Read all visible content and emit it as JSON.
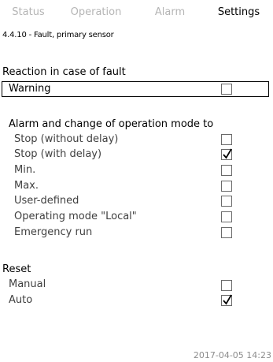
{
  "tabs": [
    {
      "label": "Status",
      "active": false
    },
    {
      "label": "Operation",
      "active": false
    },
    {
      "label": "Alarm",
      "active": false
    },
    {
      "label": "Settings",
      "active": true
    }
  ],
  "menu_path": "4.4.10 - Fault, primary sensor",
  "reaction_section": {
    "title": "Reaction in case of fault",
    "warning": {
      "label": "Warning",
      "checked": false
    }
  },
  "alarm_section": {
    "title": "Alarm and change of operation mode to",
    "items": [
      {
        "label": "Stop (without delay)",
        "checked": false
      },
      {
        "label": "Stop (with delay)",
        "checked": true
      },
      {
        "label": "Min.",
        "checked": false
      },
      {
        "label": "Max.",
        "checked": false
      },
      {
        "label": "User-defined",
        "checked": false
      },
      {
        "label": "Operating mode \"Local\"",
        "checked": false
      },
      {
        "label": "Emergency run",
        "checked": false
      }
    ]
  },
  "reset_section": {
    "title": "Reset",
    "items": [
      {
        "label": "Manual",
        "checked": false
      },
      {
        "label": "Auto",
        "checked": true
      }
    ]
  },
  "datetime": "2017-04-05 14:23",
  "colors": {
    "active_tab_text": "#000000",
    "inactive_tab_text": "#b5b5b5",
    "item_text": "#404040",
    "datetime_text": "#8c8c8c"
  }
}
